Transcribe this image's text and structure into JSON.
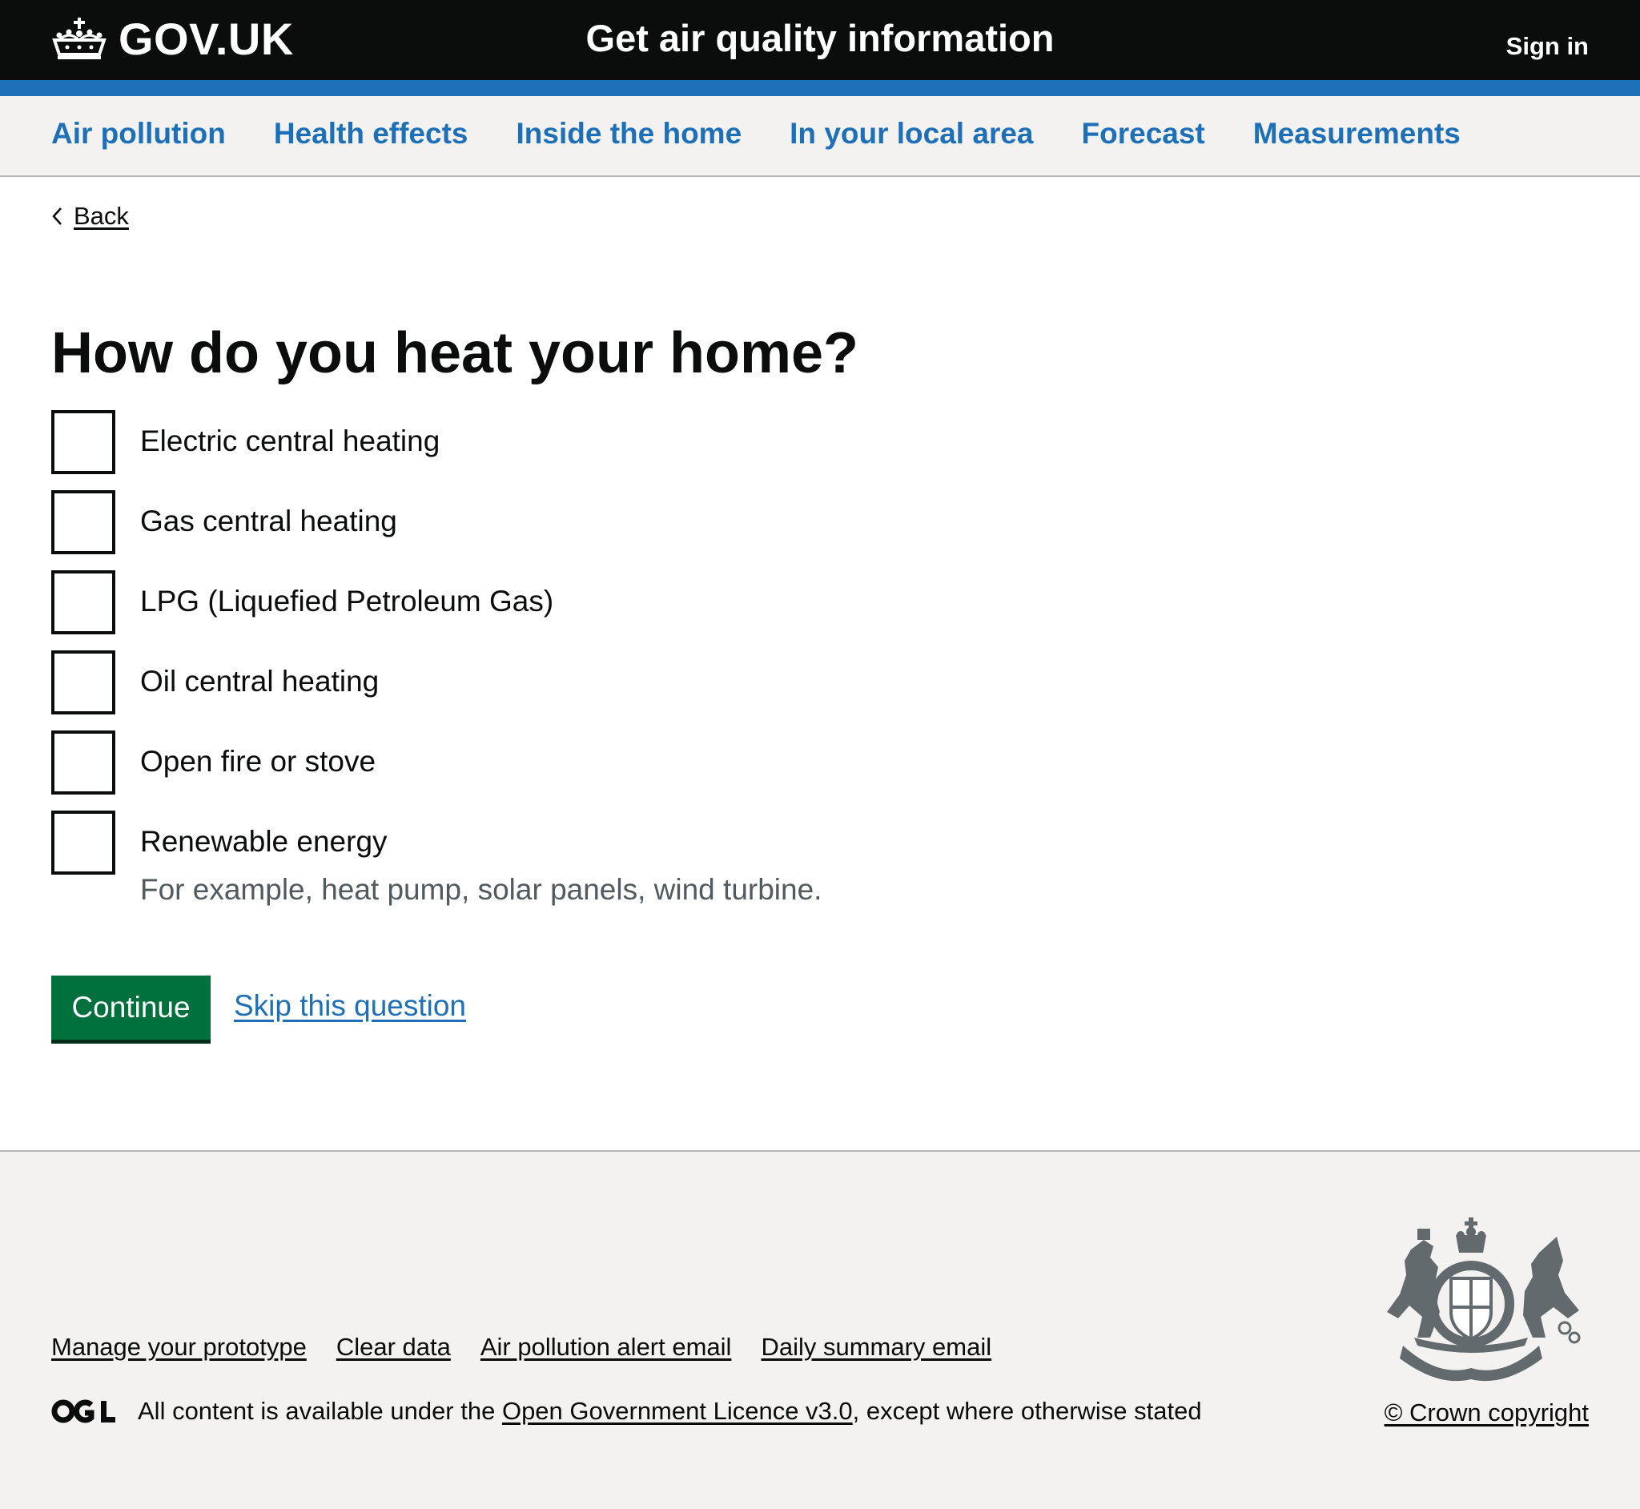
{
  "header": {
    "logo_text": "GOV.UK",
    "logo_icon": "crown-icon",
    "service_name": "Get air quality information",
    "sign_in": "Sign in"
  },
  "nav": {
    "items": [
      {
        "label": "Air pollution"
      },
      {
        "label": "Health effects"
      },
      {
        "label": "Inside the home"
      },
      {
        "label": "In your local area"
      },
      {
        "label": "Forecast"
      },
      {
        "label": "Measurements"
      }
    ]
  },
  "back": {
    "label": "Back",
    "icon": "chevron-left-icon"
  },
  "question": {
    "heading": "How do you heat your home?",
    "options": [
      {
        "label": "Electric central heating",
        "checked": false
      },
      {
        "label": "Gas central heating",
        "checked": false
      },
      {
        "label": "LPG (Liquefied Petroleum Gas)",
        "checked": false
      },
      {
        "label": "Oil central heating",
        "checked": false
      },
      {
        "label": "Open fire or stove",
        "checked": false
      },
      {
        "label": "Renewable energy",
        "hint": "For example, heat pump, solar panels, wind turbine.",
        "checked": false
      }
    ]
  },
  "actions": {
    "continue_label": "Continue",
    "skip_label": "Skip this question"
  },
  "footer": {
    "links": [
      {
        "label": "Manage your prototype"
      },
      {
        "label": "Clear data"
      },
      {
        "label": "Air pollution alert email"
      },
      {
        "label": "Daily summary email"
      }
    ],
    "ogl_logo": "ogl-logo-icon",
    "licence_prefix": "All content is available under the ",
    "licence_link": "Open Government Licence v3.0",
    "licence_suffix": ", except where otherwise stated",
    "crest_icon": "royal-coat-of-arms-icon",
    "copyright": "© Crown copyright"
  },
  "colors": {
    "header_bg": "#0b0c0c",
    "header_accent": "#1d70b8",
    "link": "#1d70b8",
    "button": "#00703c",
    "hint_text": "#505a5f",
    "footer_bg": "#f3f2f1"
  }
}
